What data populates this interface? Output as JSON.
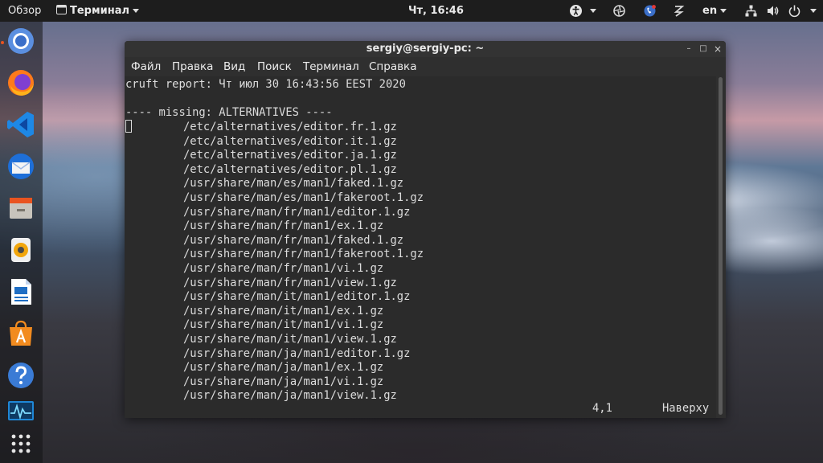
{
  "topbar": {
    "overview": "Обзор",
    "app_menu": "Терминал",
    "clock": "Чт, 16:46",
    "lang": "en"
  },
  "dock": {
    "apps": [
      "chromium-icon",
      "firefox-icon",
      "vscode-icon",
      "mail-client-icon",
      "file-manager-icon",
      "media-player-icon",
      "writer-document-icon",
      "software-center-icon",
      "help-icon",
      "system-monitor-icon",
      "app-grid-icon"
    ]
  },
  "window": {
    "title": "sergiy@sergiy-pc: ~",
    "buttons": {
      "minimize": "–",
      "maximize": "□",
      "close": "×"
    },
    "menu": [
      "Файл",
      "Правка",
      "Вид",
      "Поиск",
      "Терминал",
      "Справка"
    ]
  },
  "terminal": {
    "header": "cruft report: Чт июл 30 16:43:56 EEST 2020",
    "section": "---- missing: ALTERNATIVES ----",
    "files": [
      "/etc/alternatives/editor.fr.1.gz",
      "/etc/alternatives/editor.it.1.gz",
      "/etc/alternatives/editor.ja.1.gz",
      "/etc/alternatives/editor.pl.1.gz",
      "/usr/share/man/es/man1/faked.1.gz",
      "/usr/share/man/es/man1/fakeroot.1.gz",
      "/usr/share/man/fr/man1/editor.1.gz",
      "/usr/share/man/fr/man1/ex.1.gz",
      "/usr/share/man/fr/man1/faked.1.gz",
      "/usr/share/man/fr/man1/fakeroot.1.gz",
      "/usr/share/man/fr/man1/vi.1.gz",
      "/usr/share/man/fr/man1/view.1.gz",
      "/usr/share/man/it/man1/editor.1.gz",
      "/usr/share/man/it/man1/ex.1.gz",
      "/usr/share/man/it/man1/vi.1.gz",
      "/usr/share/man/it/man1/view.1.gz",
      "/usr/share/man/ja/man1/editor.1.gz",
      "/usr/share/man/ja/man1/ex.1.gz",
      "/usr/share/man/ja/man1/vi.1.gz",
      "/usr/share/man/ja/man1/view.1.gz"
    ],
    "status_position": "4,1",
    "status_scroll": "Наверху"
  }
}
